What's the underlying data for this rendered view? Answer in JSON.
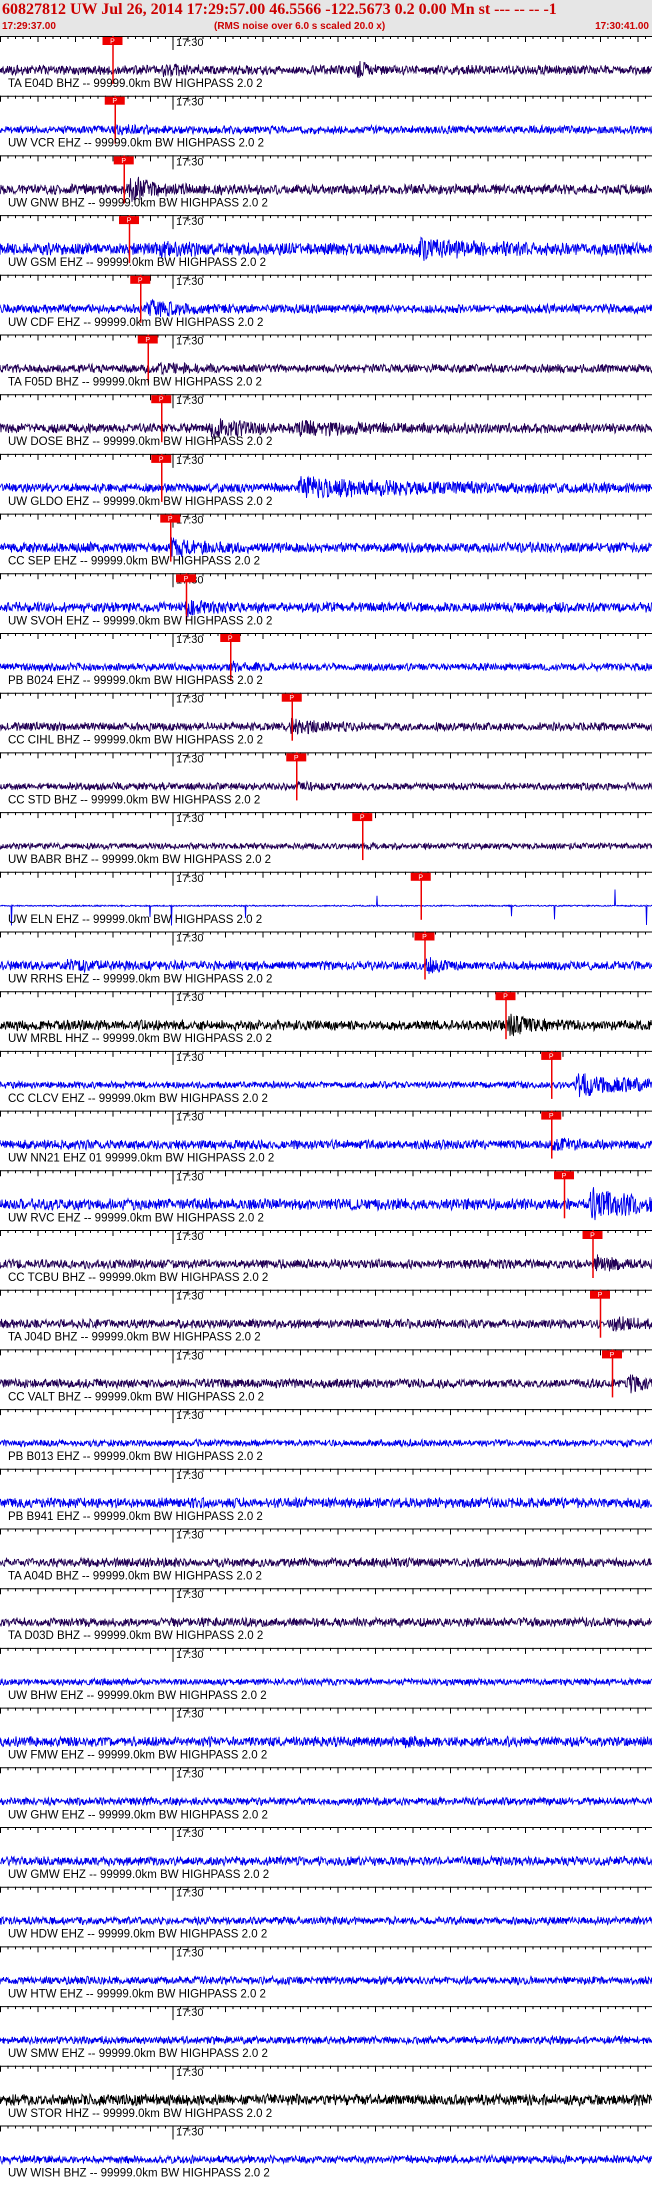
{
  "header": {
    "title": "60827812 UW Jul 26, 2014 17:29:57.00   46.5566 -122.5673  0.2 0.00 Mn st --- -- --  -1",
    "start_time": "17:29:37.00",
    "noise_note": "(RMS noise over 6.0 s scaled 20.0 x)",
    "end_time": "17:30:41.00"
  },
  "colors": {
    "header_bg": "#e6e6e6",
    "header_text": "#cc0000",
    "trace_blue": "#0000ee",
    "trace_dark": "#220055",
    "trace_black": "#000000",
    "pick_red": "#ee0000"
  },
  "minute_mark": "17:30",
  "pick_label": "P",
  "traces": [
    {
      "label": "TA E04D BHZ -- 99999.0km BW  HIGHPASS  2.0  2",
      "color": "dark",
      "pick_s": 15,
      "amp": 0.42,
      "events": [
        {
          "t": 22,
          "a": 0.8,
          "w": 3.0
        },
        {
          "t": 48,
          "a": 1.8,
          "w": 0.9
        }
      ]
    },
    {
      "label": "UW VCR EHZ -- 99999.0km BW  HIGHPASS  2.0  2",
      "color": "blue",
      "pick_s": 15.3,
      "amp": 0.36,
      "events": [
        {
          "t": 16,
          "a": 0.6,
          "w": 3.0
        }
      ]
    },
    {
      "label": "UW GNW BHZ -- 99999.0km BW  HIGHPASS  2.0  2",
      "color": "dark",
      "pick_s": 16.5,
      "amp": 0.45,
      "events": [
        {
          "t": 17.5,
          "a": 2.2,
          "w": 3.0
        }
      ]
    },
    {
      "label": "UW GSM EHZ -- 99999.0km BW  HIGHPASS  2.0  2",
      "color": "blue",
      "pick_s": 17.2,
      "amp": 0.55,
      "events": [
        {
          "t": 21,
          "a": 0.7,
          "w": 3.0
        },
        {
          "t": 56,
          "a": 1.3,
          "w": 6.0
        }
      ]
    },
    {
      "label": "UW CDF EHZ -- 99999.0km BW  HIGHPASS  2.0  2",
      "color": "blue",
      "pick_s": 18.7,
      "amp": 0.4,
      "events": [
        {
          "t": 20,
          "a": 1.8,
          "w": 3.0
        }
      ]
    },
    {
      "label": "TA F05D BHZ -- 99999.0km BW  HIGHPASS  2.0  2",
      "color": "dark",
      "pick_s": 19.7,
      "amp": 0.38,
      "events": [
        {
          "t": 21,
          "a": 0.9,
          "w": 3.0
        }
      ]
    },
    {
      "label": "UW DOSE BHZ -- 99999.0km BW  HIGHPASS  2.0  2",
      "color": "dark",
      "pick_s": 21.5,
      "amp": 0.42,
      "events": [
        {
          "t": 28.5,
          "a": 2.0,
          "w": 4.0
        },
        {
          "t": 40,
          "a": 0.9,
          "w": 10.0
        }
      ]
    },
    {
      "label": "UW GLDO EHZ -- 99999.0km BW  HIGHPASS  2.0  2",
      "color": "blue",
      "pick_s": 21.5,
      "amp": 0.4,
      "events": [
        {
          "t": 40,
          "a": 2.0,
          "w": 15.0
        }
      ]
    },
    {
      "label": "CC SEP EHZ -- 99999.0km BW  HIGHPASS  2.0  2",
      "color": "blue",
      "pick_s": 22.7,
      "amp": 0.45,
      "events": [
        {
          "t": 23,
          "a": 1.5,
          "w": 3.0
        }
      ]
    },
    {
      "label": "UW SVOH EHZ -- 99999.0km BW  HIGHPASS  2.0  2",
      "color": "blue",
      "pick_s": 24.8,
      "amp": 0.45,
      "events": [
        {
          "t": 25,
          "a": 1.2,
          "w": 3.0
        }
      ]
    },
    {
      "label": "PB B024 EHZ -- 99999.0km BW  HIGHPASS  2.0  2",
      "color": "blue",
      "pick_s": 30.7,
      "amp": 0.35,
      "events": [
        {
          "t": 31,
          "a": 0.6,
          "w": 3.0
        }
      ]
    },
    {
      "label": "CC CIHL BHZ -- 99999.0km BW  HIGHPASS  2.0  2",
      "color": "dark",
      "pick_s": 38.9,
      "amp": 0.38,
      "events": [
        {
          "t": 39,
          "a": 1.4,
          "w": 3.0
        }
      ]
    },
    {
      "label": "CC STD BHZ -- 99999.0km BW  HIGHPASS  2.0  2",
      "color": "dark",
      "pick_s": 39.5,
      "amp": 0.32,
      "events": [
        {
          "t": 40,
          "a": 0.6,
          "w": 3.0
        }
      ]
    },
    {
      "label": "UW BABR BHZ -- 99999.0km BW  HIGHPASS  2.0  2",
      "color": "dark",
      "pick_s": 48.3,
      "amp": 0.28,
      "events": [
        {
          "t": 49,
          "a": 0.3,
          "w": 3.0
        }
      ]
    },
    {
      "label": "UW ELN EHZ -- 99999.0km BW  HIGHPASS  2.0  2",
      "color": "blue",
      "pick_s": 56.1,
      "amp": 0.06,
      "spikes": true,
      "events": []
    },
    {
      "label": "UW RRHS EHZ -- 99999.0km BW  HIGHPASS  2.0  2",
      "color": "blue",
      "pick_s": 56.6,
      "amp": 0.4,
      "events": [
        {
          "t": 9,
          "a": 0.7,
          "w": 5.0
        },
        {
          "t": 57,
          "a": 1.2,
          "w": 2.0
        }
      ]
    },
    {
      "label": "UW MRBL HHZ -- 99999.0km BW  HIGHPASS  2.0  2",
      "color": "black",
      "pick_s": 67.4,
      "amp": 0.45,
      "events": [
        {
          "t": 68,
          "a": 1.8,
          "w": 3.0
        }
      ]
    },
    {
      "label": "CC CLCV EHZ -- 99999.0km BW  HIGHPASS  2.0  2",
      "color": "blue",
      "pick_s": 73.5,
      "amp": 0.3,
      "events": [
        {
          "t": 77,
          "a": 3.2,
          "w": 9.0
        }
      ]
    },
    {
      "label": "UW NN21 EHZ 01 99999.0km BW  HIGHPASS  2.0  2",
      "color": "blue",
      "pick_s": 73.5,
      "amp": 0.42,
      "events": [
        {
          "t": 74,
          "a": 0.8,
          "w": 3.0
        }
      ]
    },
    {
      "label": "UW RVC EHZ -- 99999.0km BW  HIGHPASS  2.0  2",
      "color": "blue",
      "pick_s": 75.2,
      "amp": 0.5,
      "events": [
        {
          "t": 79,
          "a": 2.4,
          "w": 6.0
        }
      ]
    },
    {
      "label": "CC TCBU BHZ -- 99999.0km BW  HIGHPASS  2.0  2",
      "color": "dark",
      "pick_s": 79.0,
      "amp": 0.4,
      "events": [
        {
          "t": 79.5,
          "a": 1.4,
          "w": 3.0
        }
      ]
    },
    {
      "label": "TA J04D BHZ -- 99999.0km BW  HIGHPASS  2.0  2",
      "color": "dark",
      "pick_s": 80.0,
      "amp": 0.4,
      "events": [
        {
          "t": 82,
          "a": 1.0,
          "w": 4.0
        }
      ]
    },
    {
      "label": "CC VALT BHZ -- 99999.0km BW  HIGHPASS  2.0  2",
      "color": "dark",
      "pick_s": 81.6,
      "amp": 0.4,
      "events": [
        {
          "t": 84,
          "a": 1.4,
          "w": 3.0
        }
      ]
    },
    {
      "label": "PB B013 EHZ -- 99999.0km BW  HIGHPASS  2.0  2",
      "color": "blue",
      "amp": 0.3,
      "events": []
    },
    {
      "label": "PB B941 EHZ -- 99999.0km BW  HIGHPASS  2.0  2",
      "color": "blue",
      "amp": 0.45,
      "events": []
    },
    {
      "label": "TA A04D BHZ -- 99999.0km BW  HIGHPASS  2.0  2",
      "color": "dark",
      "amp": 0.4,
      "events": []
    },
    {
      "label": "TA D03D BHZ -- 99999.0km BW  HIGHPASS  2.0  2",
      "color": "dark",
      "amp": 0.4,
      "events": []
    },
    {
      "label": "UW BHW EHZ -- 99999.0km BW  HIGHPASS  2.0  2",
      "color": "blue",
      "amp": 0.3,
      "events": []
    },
    {
      "label": "UW FMW EHZ -- 99999.0km BW  HIGHPASS  2.0  2",
      "color": "blue",
      "amp": 0.45,
      "events": [
        {
          "t": 54,
          "a": 0.8,
          "w": 1.0
        }
      ]
    },
    {
      "label": "UW GHW EHZ -- 99999.0km BW  HIGHPASS  2.0  2",
      "color": "blue",
      "amp": 0.35,
      "events": []
    },
    {
      "label": "UW GMW EHZ -- 99999.0km BW  HIGHPASS  2.0  2",
      "color": "blue",
      "amp": 0.4,
      "events": []
    },
    {
      "label": "UW HDW EHZ -- 99999.0km BW  HIGHPASS  2.0  2",
      "color": "blue",
      "amp": 0.35,
      "events": []
    },
    {
      "label": "UW HTW EHZ -- 99999.0km BW  HIGHPASS  2.0  2",
      "color": "blue",
      "amp": 0.35,
      "events": []
    },
    {
      "label": "UW SMW EHZ -- 99999.0km BW  HIGHPASS  2.0  2",
      "color": "blue",
      "amp": 0.35,
      "events": []
    },
    {
      "label": "UW STOR HHZ -- 99999.0km BW  HIGHPASS  2.0  2",
      "color": "black",
      "amp": 0.5,
      "events": []
    },
    {
      "label": "UW WISH BHZ -- 99999.0km BW  HIGHPASS  2.0  2",
      "color": "blue",
      "amp": 0.35,
      "events": []
    }
  ]
}
